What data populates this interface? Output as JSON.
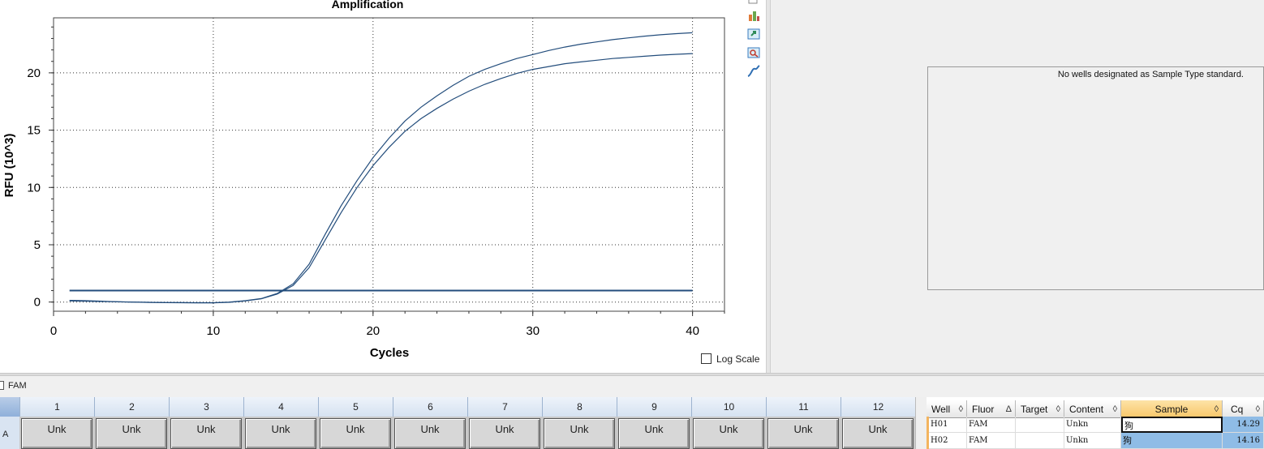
{
  "chart_data": {
    "type": "line",
    "title": "Amplification",
    "xlabel": "Cycles",
    "ylabel": "RFU (10^3)",
    "xlim": [
      0,
      42
    ],
    "ylim": [
      -0.8,
      24.8
    ],
    "xticks": [
      0,
      10,
      20,
      30,
      40
    ],
    "yticks": [
      0,
      5,
      10,
      15,
      20
    ],
    "grid": true,
    "line_color": "#234d7c",
    "series": [
      {
        "x": [
          1,
          2,
          3,
          4,
          5,
          6,
          7,
          8,
          9,
          10,
          11,
          12,
          13,
          14,
          15,
          16,
          17,
          18,
          19,
          20,
          21,
          22,
          23,
          24,
          25,
          26,
          27,
          28,
          29,
          30,
          31,
          32,
          33,
          34,
          35,
          36,
          37,
          38,
          39,
          40
        ],
        "values": [
          0.15,
          0.12,
          0.08,
          0.03,
          0.0,
          -0.02,
          -0.04,
          -0.05,
          -0.06,
          -0.06,
          0.0,
          0.12,
          0.3,
          0.75,
          1.6,
          3.3,
          5.9,
          8.4,
          10.6,
          12.6,
          14.3,
          15.8,
          17.0,
          18.0,
          18.9,
          19.7,
          20.3,
          20.8,
          21.25,
          21.6,
          21.95,
          22.25,
          22.5,
          22.7,
          22.9,
          23.05,
          23.2,
          23.32,
          23.42,
          23.5
        ]
      },
      {
        "x": [
          1,
          2,
          3,
          4,
          5,
          6,
          7,
          8,
          9,
          10,
          11,
          12,
          13,
          14,
          15,
          16,
          17,
          18,
          19,
          20,
          21,
          22,
          23,
          24,
          25,
          26,
          27,
          28,
          29,
          30,
          31,
          32,
          33,
          34,
          35,
          36,
          37,
          38,
          39,
          40
        ],
        "values": [
          0.1,
          0.08,
          0.05,
          0.02,
          -0.01,
          -0.03,
          -0.05,
          -0.06,
          -0.07,
          -0.07,
          -0.02,
          0.1,
          0.28,
          0.7,
          1.45,
          3.0,
          5.4,
          7.8,
          10.0,
          11.9,
          13.5,
          14.9,
          16.0,
          16.9,
          17.7,
          18.4,
          19.0,
          19.5,
          19.95,
          20.3,
          20.55,
          20.8,
          20.95,
          21.1,
          21.25,
          21.35,
          21.45,
          21.55,
          21.62,
          21.68
        ]
      }
    ],
    "threshold": 1.0
  },
  "log_scale_label": "Log Scale",
  "standard_curve_message": "No wells designated as Sample Type standard.",
  "fluorophore_filter": {
    "label": "FAM"
  },
  "plate": {
    "columns": [
      "1",
      "2",
      "3",
      "4",
      "5",
      "6",
      "7",
      "8",
      "9",
      "10",
      "11",
      "12"
    ],
    "rows": [
      {
        "label": "A",
        "wells": [
          "Unk",
          "Unk",
          "Unk",
          "Unk",
          "Unk",
          "Unk",
          "Unk",
          "Unk",
          "Unk",
          "Unk",
          "Unk",
          "Unk"
        ]
      }
    ]
  },
  "table": {
    "headers": [
      {
        "label": "Well",
        "sort": "◊"
      },
      {
        "label": "Fluor",
        "sort": "Δ"
      },
      {
        "label": "Target",
        "sort": "◊"
      },
      {
        "label": "Content",
        "sort": "◊"
      },
      {
        "label": "Sample",
        "sort": "◊"
      },
      {
        "label": "Cq",
        "sort": "◊"
      }
    ],
    "rows": [
      {
        "well": "H01",
        "fluor": "FAM",
        "target": "",
        "content": "Unkn",
        "sample": "狗",
        "cq": "14.29"
      },
      {
        "well": "H02",
        "fluor": "FAM",
        "target": "",
        "content": "Unkn",
        "sample": "狗",
        "cq": "14.16"
      }
    ]
  },
  "colors": {
    "highlight": "#8fbce6",
    "active_header": "#f8c76a",
    "row_marker": "#f3b45f"
  }
}
